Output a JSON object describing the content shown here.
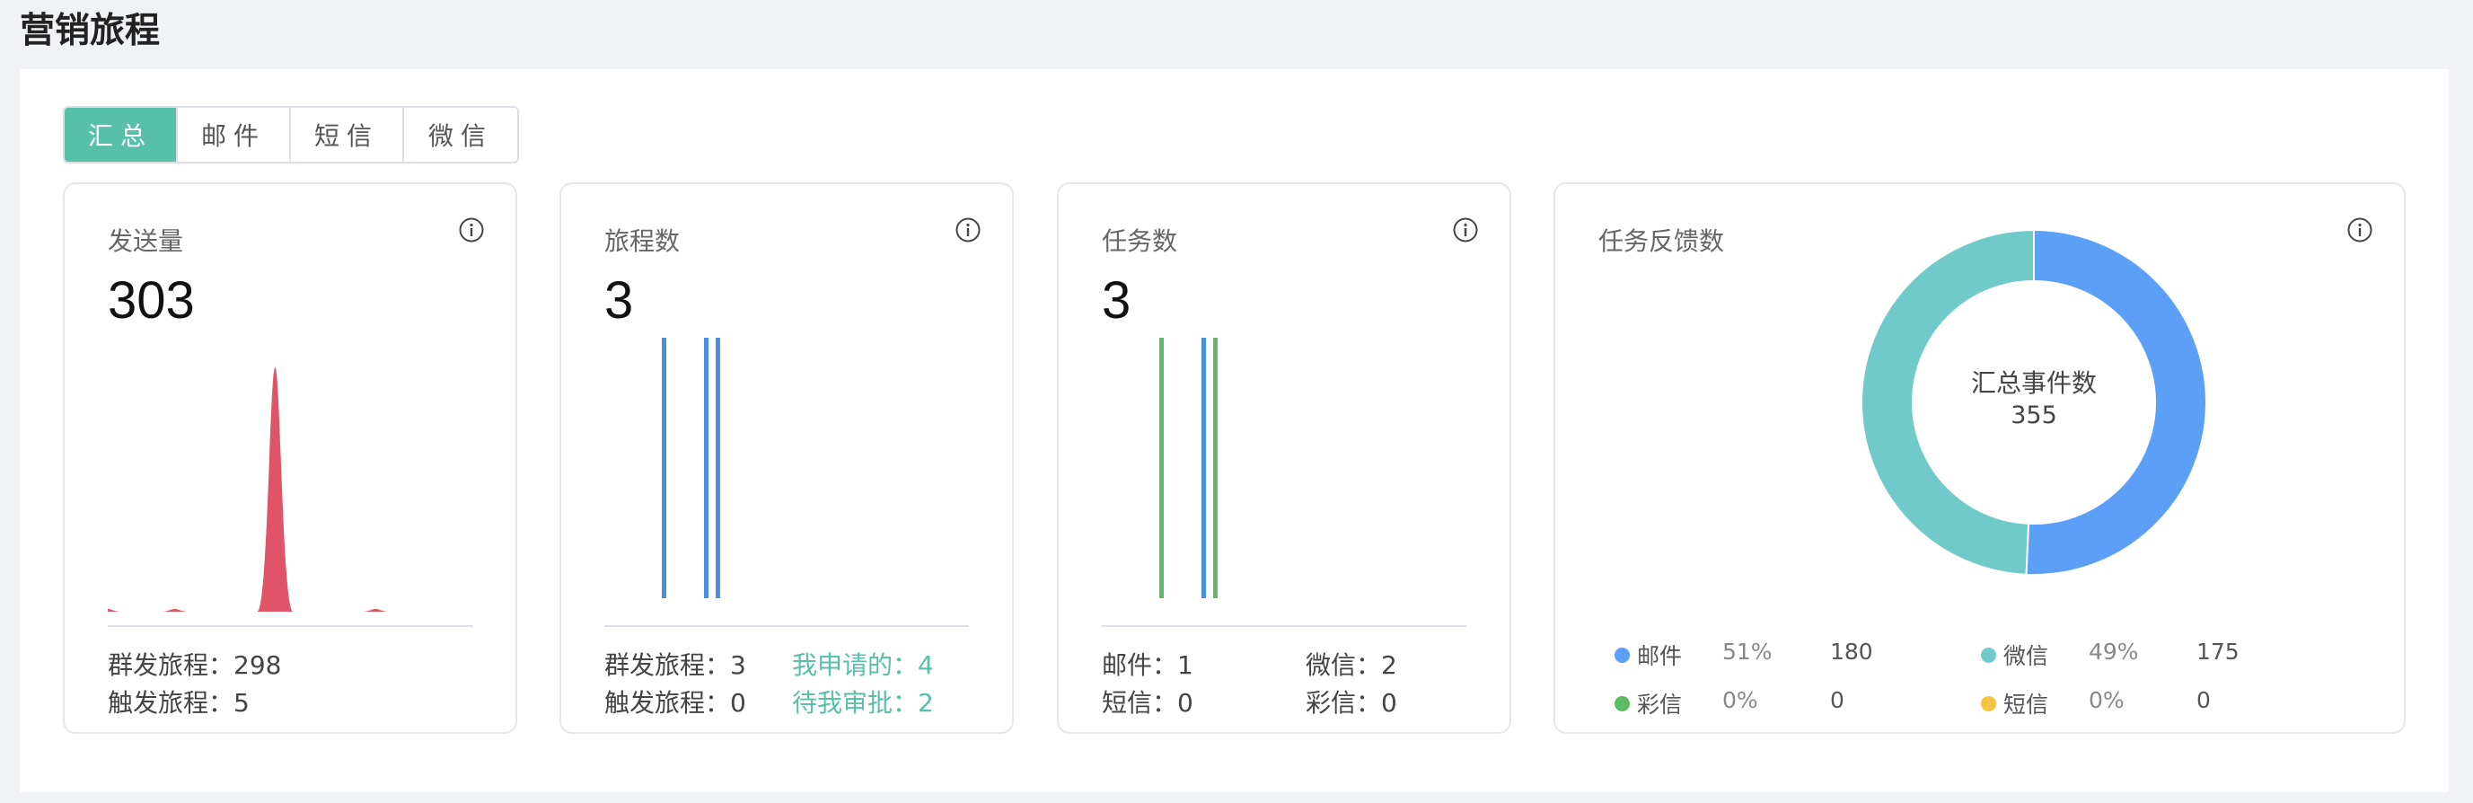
{
  "page": {
    "title": "营销旅程"
  },
  "tabs": [
    {
      "label": "汇总",
      "active": true
    },
    {
      "label": "邮件",
      "active": false
    },
    {
      "label": "短信",
      "active": false
    },
    {
      "label": "微信",
      "active": false
    }
  ],
  "cards": {
    "send_volume": {
      "title": "发送量",
      "value": "303",
      "stats": [
        {
          "label": "群发旅程：",
          "value": "298"
        },
        {
          "label": "触发旅程：",
          "value": "5"
        }
      ]
    },
    "journeys": {
      "title": "旅程数",
      "value": "3",
      "stats": {
        "mass": {
          "label": "群发旅程：",
          "value": "3"
        },
        "trigger": {
          "label": "触发旅程：",
          "value": "0"
        },
        "applied": {
          "label": "我申请的：",
          "value": "4"
        },
        "pending": {
          "label": "待我审批：",
          "value": "2"
        }
      }
    },
    "tasks": {
      "title": "任务数",
      "value": "3",
      "stats": {
        "email": {
          "label": "邮件：",
          "value": "1"
        },
        "wechat": {
          "label": "微信：",
          "value": "2"
        },
        "sms": {
          "label": "短信：",
          "value": "0"
        },
        "mms": {
          "label": "彩信：",
          "value": "0"
        }
      }
    },
    "feedback": {
      "title": "任务反馈数",
      "center_label": "汇总事件数",
      "center_value": "355",
      "legend": [
        {
          "name": "邮件",
          "pct": "51%",
          "value": "180",
          "color": "#5b9ff7"
        },
        {
          "name": "微信",
          "pct": "49%",
          "value": "175",
          "color": "#70cac9"
        },
        {
          "name": "彩信",
          "pct": "0%",
          "value": "0",
          "color": "#5dbb63"
        },
        {
          "name": "短信",
          "pct": "0%",
          "value": "0",
          "color": "#f5c342"
        }
      ]
    }
  },
  "chart_data": [
    {
      "type": "area",
      "series": [
        {
          "values": [
            1,
            0,
            3,
            0,
            0,
            303,
            0,
            0,
            1,
            0,
            0,
            0
          ]
        }
      ],
      "color": "#e05468",
      "ylim": [
        0,
        303
      ]
    },
    {
      "type": "bar",
      "series": [
        {
          "values": [
            1,
            1,
            1
          ]
        }
      ],
      "color": "#4a90e2"
    },
    {
      "type": "bar",
      "series": [
        {
          "values": [
            1,
            1,
            1
          ]
        }
      ],
      "colors": [
        "#5dbb63",
        "#4a90e2",
        "#5dbb63"
      ]
    },
    {
      "type": "pie",
      "categories": [
        "邮件",
        "微信",
        "彩信",
        "短信"
      ],
      "values": [
        180,
        175,
        0,
        0
      ],
      "colors": [
        "#5b9ff7",
        "#70cac9",
        "#5dbb63",
        "#f5c342"
      ]
    }
  ]
}
